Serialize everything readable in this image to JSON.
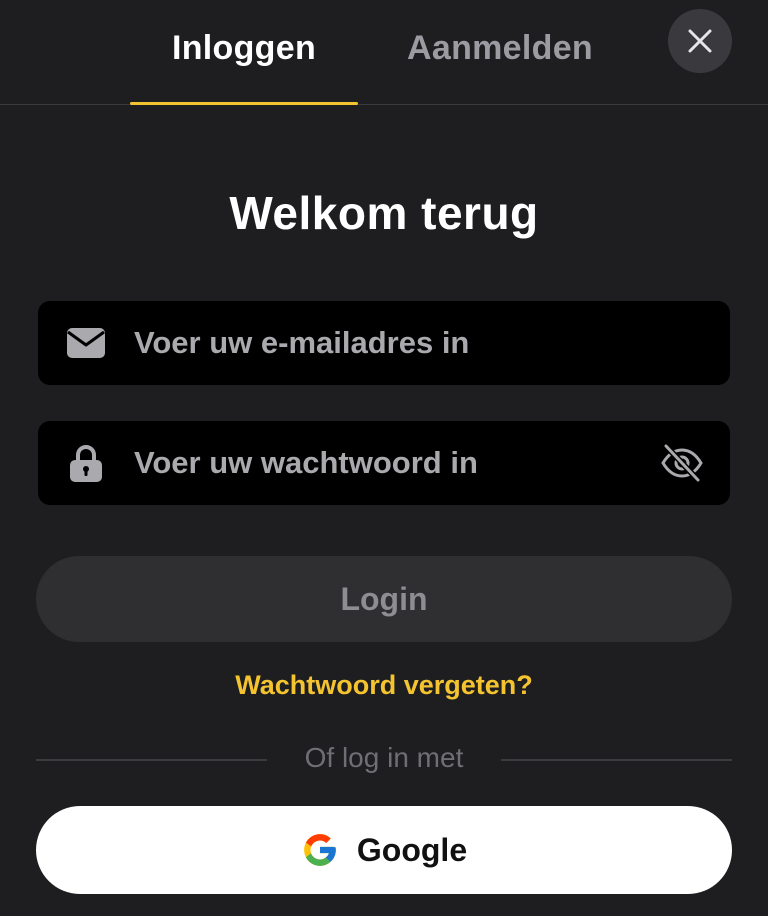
{
  "tabs": {
    "login_label": "Inloggen",
    "register_label": "Aanmelden",
    "active": "login"
  },
  "close": {
    "icon": "close-icon"
  },
  "title": "Welkom terug",
  "email": {
    "placeholder": "Voer uw e-mailadres in",
    "value": "",
    "icon": "envelope-icon"
  },
  "password": {
    "placeholder": "Voer uw wachtwoord in",
    "value": "",
    "icon": "lock-icon",
    "toggle_icon": "eye-slash-icon"
  },
  "login_button": "Login",
  "forgot_link": "Wachtwoord vergeten?",
  "divider_text": "Of log in met",
  "google_button": "Google",
  "colors": {
    "background": "#1e1e20",
    "accent": "#f4c430",
    "input_background": "#000000",
    "login_button_background": "#2f2f32",
    "google_button_background": "#ffffff"
  }
}
